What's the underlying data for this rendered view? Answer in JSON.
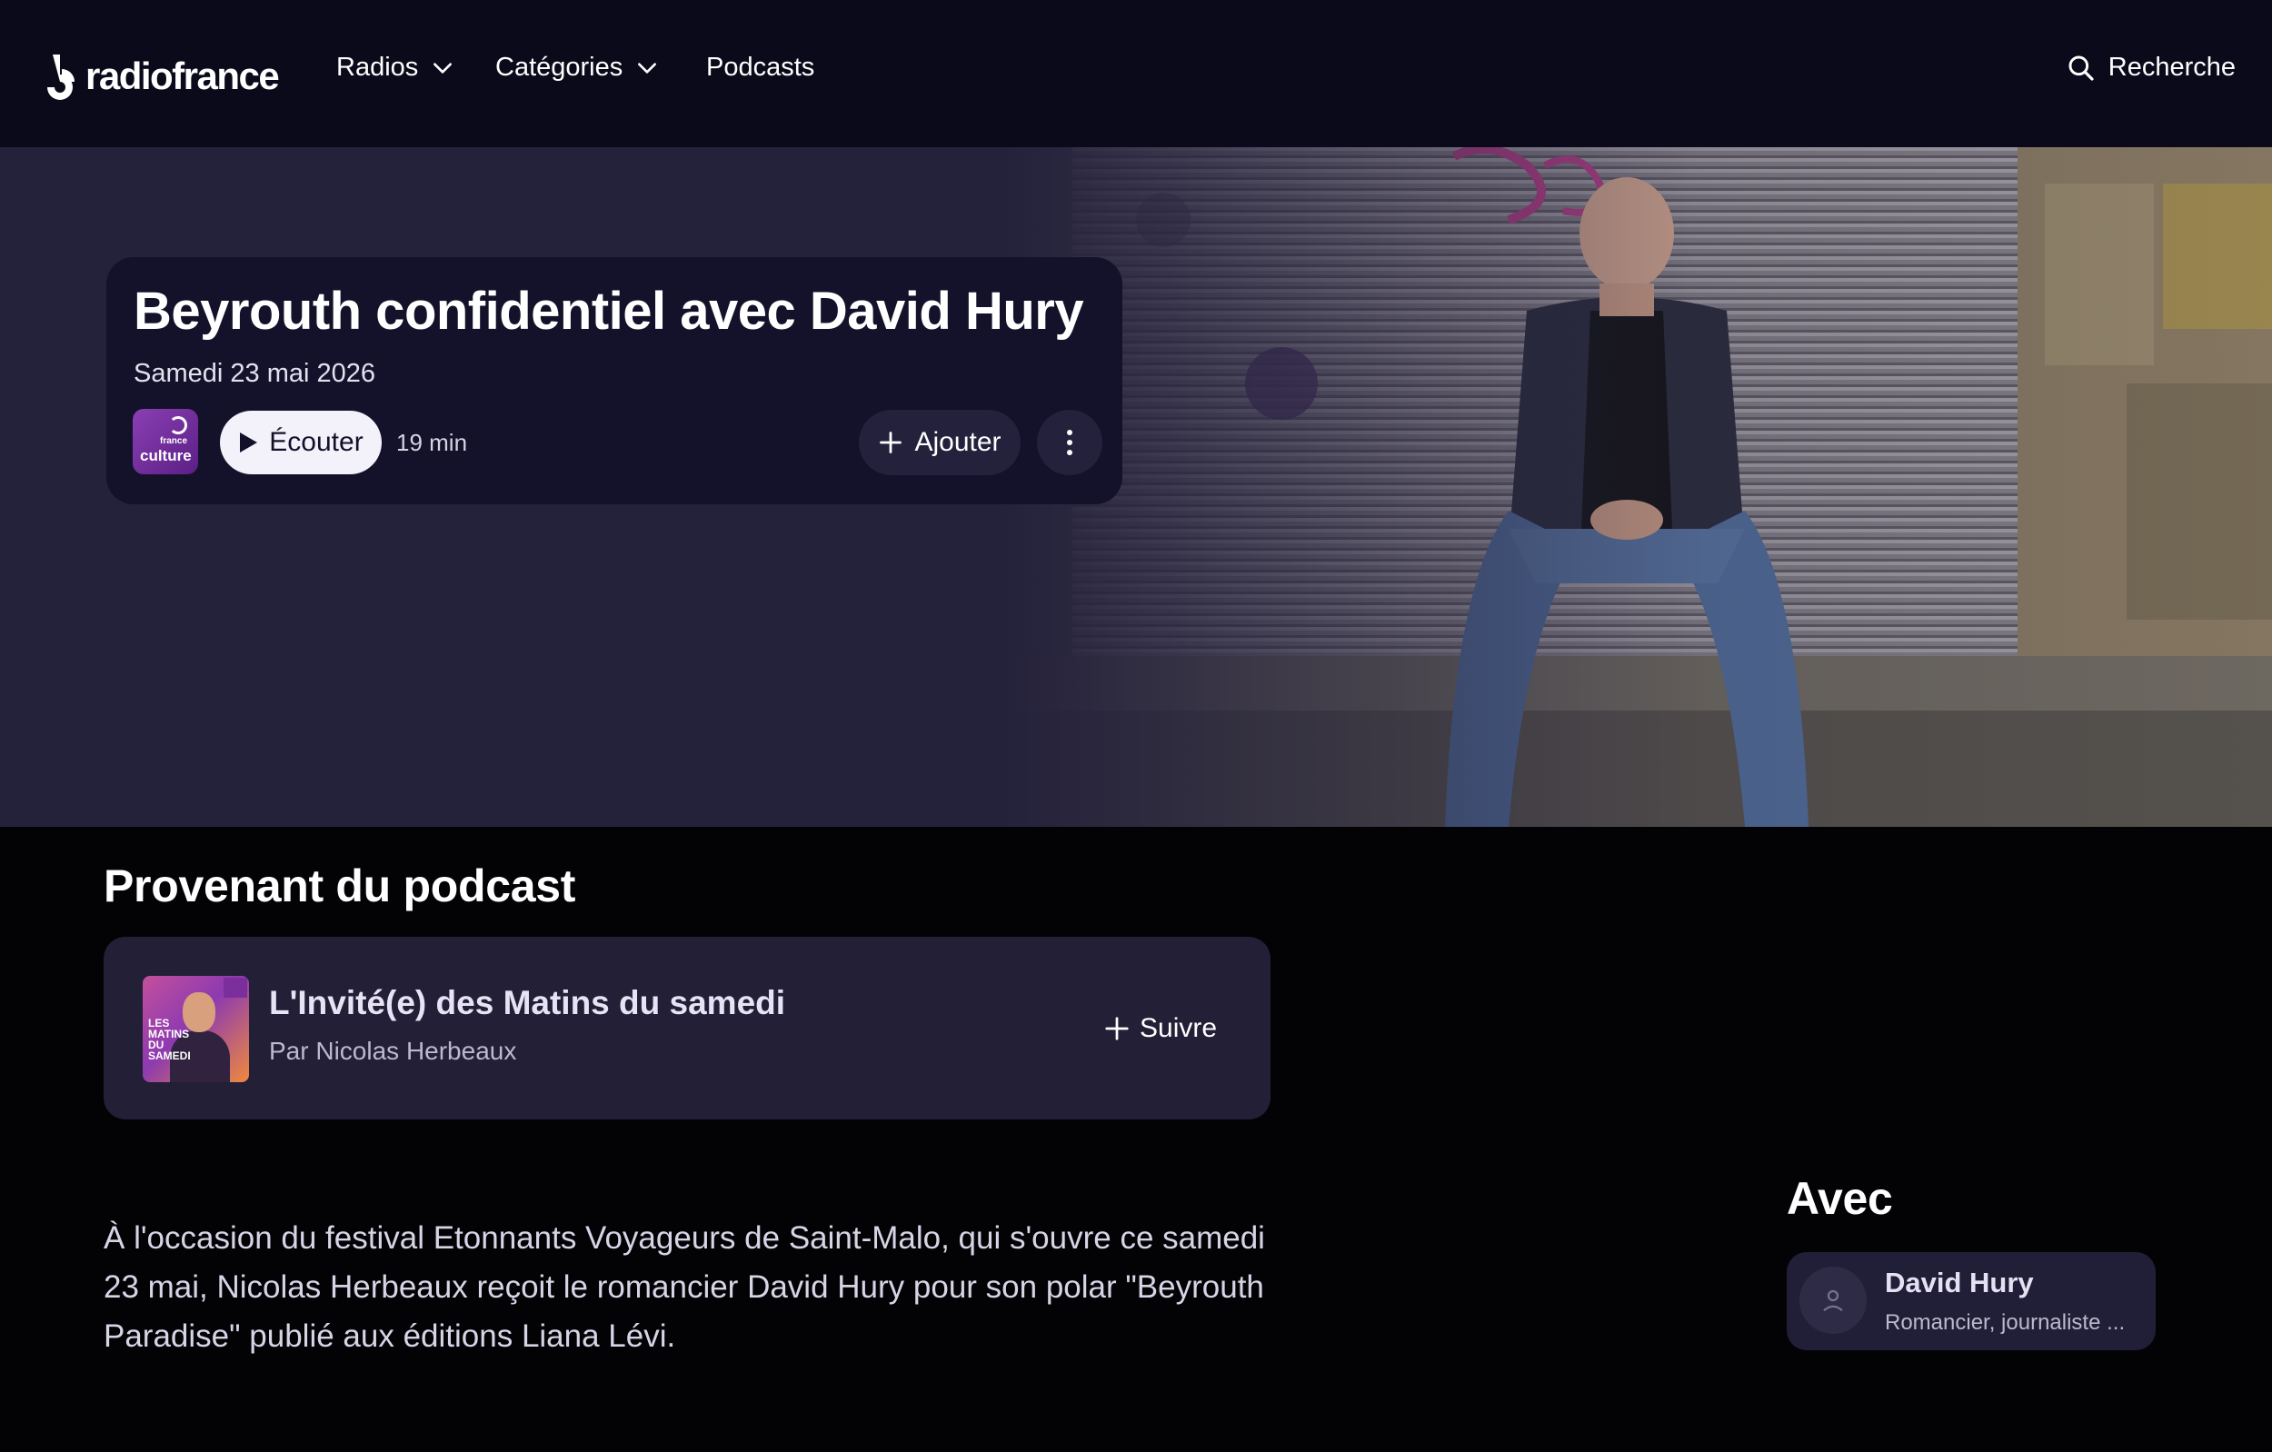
{
  "header": {
    "logo_text": "radiofrance",
    "nav": [
      {
        "label": "Radios"
      },
      {
        "label": "Catégories"
      },
      {
        "label": "Podcasts"
      }
    ],
    "search_label": "Recherche"
  },
  "episode": {
    "title": "Beyrouth confidentiel avec David Hury",
    "date": "Samedi 23 mai 2026",
    "station_logo": {
      "line1": "france",
      "line2": "culture"
    },
    "listen_label": "Écouter",
    "duration": "19 min",
    "add_label": "Ajouter"
  },
  "podcast_section": {
    "heading": "Provenant du podcast",
    "title": "L'Invité(e) des Matins du samedi",
    "author": "Par Nicolas Herbeaux",
    "cover_text": "LES MATINS DU SAMEDI",
    "follow_label": "Suivre"
  },
  "description": "À l'occasion du festival Etonnants Voyageurs de Saint-Malo, qui s'ouvre ce samedi 23 mai, Nicolas Herbeaux reçoit le romancier David Hury pour son polar \"Beyrouth Paradise\" publié aux éditions Liana Lévi.",
  "with_section": {
    "heading": "Avec",
    "person_name": "David Hury",
    "person_role": "Romancier, journaliste ..."
  },
  "colors": {
    "header_bg": "#0b0a1b",
    "hero_bg": "#24213b",
    "card_bg": "#14122a",
    "page_bg": "#030306",
    "accent_purple": "#7a2f9c"
  }
}
